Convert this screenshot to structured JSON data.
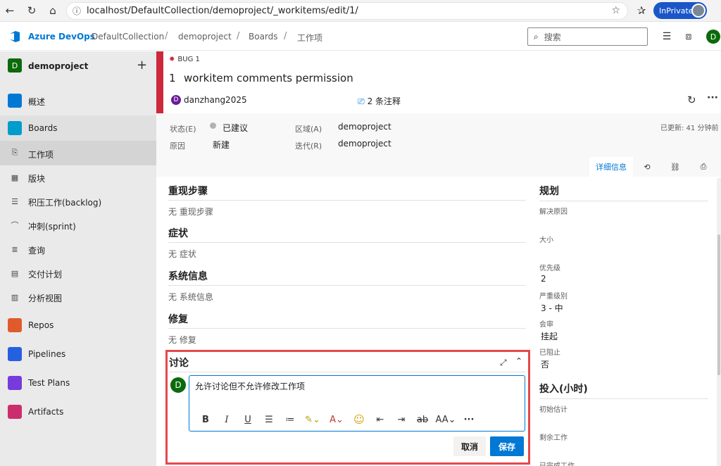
{
  "browser": {
    "url": "localhost/DefaultCollection/demoproject/_workitems/edit/1/",
    "inprivate_label": "InPrivate"
  },
  "header": {
    "brand": "Azure DevOps",
    "breadcrumbs": [
      "DefaultCollection",
      "demoproject",
      "Boards",
      "工作项"
    ],
    "search_placeholder": "搜索",
    "user_initial": "D"
  },
  "sidebar": {
    "project_initial": "D",
    "project_name": "demoproject",
    "items": [
      {
        "label": "概述",
        "icon": "overview-icon",
        "color": "#0078d4"
      },
      {
        "label": "Boards",
        "icon": "boards-icon",
        "color": "#009ccc"
      },
      {
        "label": "工作项",
        "icon": "work-items-icon"
      },
      {
        "label": "版块",
        "icon": "board-icon"
      },
      {
        "label": "积压工作(backlog)",
        "icon": "backlog-icon"
      },
      {
        "label": "冲刺(sprint)",
        "icon": "sprint-icon"
      },
      {
        "label": "查询",
        "icon": "query-icon"
      },
      {
        "label": "交付计划",
        "icon": "delivery-plan-icon"
      },
      {
        "label": "分析视图",
        "icon": "analytics-icon"
      },
      {
        "label": "Repos",
        "icon": "repos-icon",
        "color": "#e05b2b"
      },
      {
        "label": "Pipelines",
        "icon": "pipelines-icon",
        "color": "#2560e0"
      },
      {
        "label": "Test Plans",
        "icon": "test-plans-icon",
        "color": "#773adc"
      },
      {
        "label": "Artifacts",
        "icon": "artifacts-icon",
        "color": "#cb2e6d"
      }
    ]
  },
  "workitem": {
    "type_label": "BUG 1",
    "id": "1",
    "title": "workitem comments permission",
    "author_initial": "D",
    "author": "danzhang2025",
    "comments": "2 条注释",
    "state_label": "状态(E)",
    "state_value": "已建议",
    "reason_label": "原因",
    "reason_value": "新建",
    "area_label": "区域(A)",
    "area_value": "demoproject",
    "iteration_label": "迭代(R)",
    "iteration_value": "demoproject",
    "updated": "已更新: 41 分钟前",
    "tabs": {
      "details": "详细信息"
    }
  },
  "sections": [
    {
      "title": "重现步骤",
      "empty": "无 重现步骤"
    },
    {
      "title": "症状",
      "empty": "无 症状"
    },
    {
      "title": "系统信息",
      "empty": "无 系统信息"
    },
    {
      "title": "修复",
      "empty": "无 修复"
    }
  ],
  "planning": {
    "title": "规划",
    "resolved_reason_label": "解决原因",
    "size_label": "大小",
    "priority_label": "优先级",
    "priority_value": "2",
    "severity_label": "严重级别",
    "severity_value": "3 - 中",
    "triage_label": "会审",
    "triage_value": "挂起",
    "blocked_label": "已阻止",
    "blocked_value": "否"
  },
  "effort": {
    "title": "投入(小时)",
    "original_label": "初始估计",
    "remaining_label": "剩余工作",
    "completed_label": "已完成工作"
  },
  "discussion": {
    "title": "讨论",
    "user_initial": "D",
    "draft": "允许讨论但不允许修改工作项",
    "cancel": "取消",
    "save": "保存"
  }
}
